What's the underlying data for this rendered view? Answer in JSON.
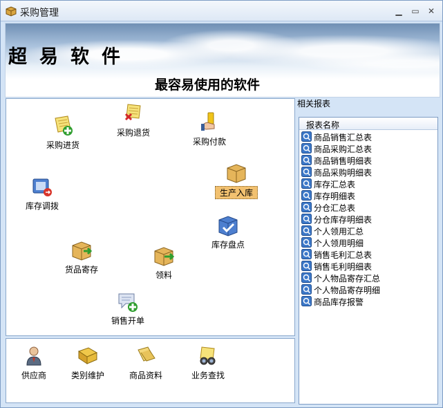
{
  "window": {
    "title": "采购管理"
  },
  "banner": {
    "brand": "超易软件",
    "slogan": "最容易使用的软件"
  },
  "workflow": {
    "purchase_in": "采购进货",
    "purchase_return": "采购退货",
    "purchase_payment": "采购付款",
    "production_in": "生产入库",
    "stock_transfer": "库存调拨",
    "stock_check": "库存盘点",
    "goods_deposit": "货品寄存",
    "material_requisition": "领料",
    "sales_order": "销售开单"
  },
  "basics": {
    "supplier": "供应商",
    "category": "类别维护",
    "product_info": "商品资料",
    "business_search": "业务查找"
  },
  "reports": {
    "section_label": "相关报表",
    "column_header": "报表名称",
    "items": [
      "商品销售汇总表",
      "商品采购汇总表",
      "商品销售明细表",
      "商品采购明细表",
      "库存汇总表",
      "库存明细表",
      "分仓汇总表",
      "分仓库存明细表",
      "个人领用汇总",
      "个人领用明细",
      "销售毛利汇总表",
      "销售毛利明细表",
      "个人物品寄存汇总",
      "个人物品寄存明细",
      "商品库存报警"
    ]
  },
  "colors": {
    "accent": "#d4e4f6",
    "selected": "#f2c170",
    "border": "#7d9cc4"
  }
}
